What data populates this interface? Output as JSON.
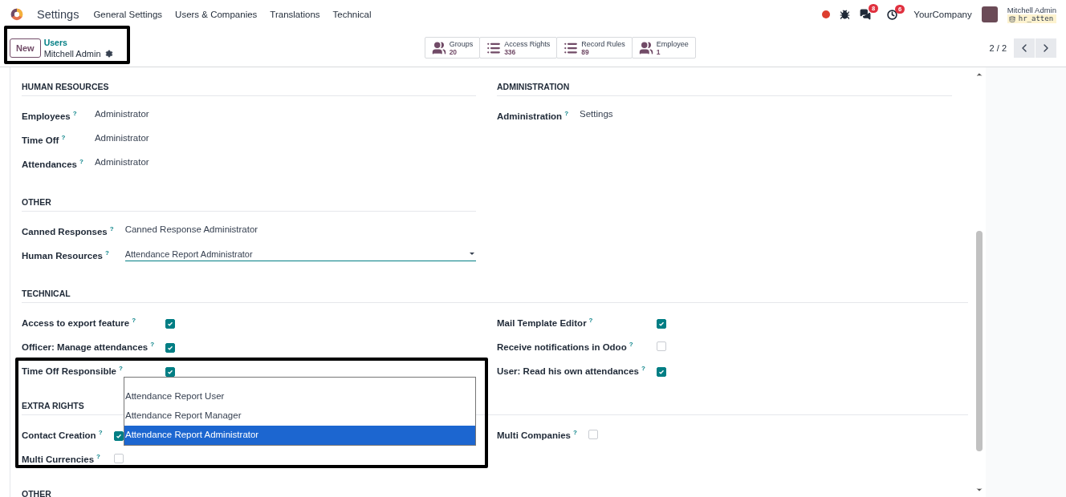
{
  "navbar": {
    "app": "Settings",
    "menus": [
      "General Settings",
      "Users & Companies",
      "Translations",
      "Technical"
    ],
    "messages_count": "8",
    "activities_count": "6",
    "company": "YourCompany",
    "user_name": "Mitchell Admin",
    "database": "hr_atten"
  },
  "control_panel": {
    "new_button": "New",
    "breadcrumb": "Users",
    "record": "Mitchell Admin",
    "smart_buttons": [
      {
        "kind": "group",
        "label": "Groups",
        "count": "20"
      },
      {
        "kind": "list",
        "label": "Access Rights",
        "count": "336"
      },
      {
        "kind": "list",
        "label": "Record Rules",
        "count": "89"
      },
      {
        "kind": "group",
        "label": "Employee",
        "count": "1"
      }
    ],
    "pager": "2 / 2"
  },
  "sections": [
    {
      "kind": "split",
      "left": {
        "title": "HUMAN RESOURCES",
        "fields": [
          {
            "kind": "value",
            "label": "Employees",
            "help": "?",
            "value": "Administrator"
          },
          {
            "kind": "value",
            "label": "Time Off",
            "help": "?",
            "value": "Administrator"
          },
          {
            "kind": "value",
            "label": "Attendances",
            "help": "?",
            "value": "Administrator"
          }
        ]
      },
      "right": {
        "title": "ADMINISTRATION",
        "fields": [
          {
            "kind": "value",
            "label": "Administration",
            "help": "?",
            "value": "Settings"
          }
        ]
      }
    },
    {
      "kind": "split",
      "left": {
        "title": "OTHER",
        "fields": [
          {
            "kind": "value",
            "label": "Canned Responses",
            "help": "?",
            "value": "Canned Response Administrator"
          },
          {
            "kind": "select",
            "label": "Human Resources",
            "help": "?",
            "value": "Attendance Report Administrator"
          }
        ]
      }
    },
    {
      "kind": "full",
      "title": "TECHNICAL",
      "left": {
        "fields": [
          {
            "kind": "checkbox",
            "label": "Access to export feature",
            "help": "?",
            "checked": true
          },
          {
            "kind": "checkbox",
            "label": "Officer: Manage attendances",
            "help": "?",
            "checked": true
          },
          {
            "kind": "checkbox",
            "label": "Time Off Responsible",
            "help": "?",
            "checked": true
          }
        ]
      },
      "right": {
        "fields": [
          {
            "kind": "checkbox",
            "label": "Mail Template Editor",
            "help": "?",
            "checked": true
          },
          {
            "kind": "checkbox",
            "label": "Receive notifications in Odoo",
            "help": "?",
            "checked": false
          },
          {
            "kind": "checkbox",
            "label": "User: Read his own attendances",
            "help": "?",
            "checked": true
          }
        ]
      }
    },
    {
      "kind": "full",
      "title": "EXTRA RIGHTS",
      "left": {
        "fields": [
          {
            "kind": "checkbox",
            "label": "Contact Creation",
            "help": "?",
            "checked": true
          },
          {
            "kind": "checkbox",
            "label": "Multi Currencies",
            "help": "?",
            "checked": false
          }
        ]
      },
      "right": {
        "fields": [
          {
            "kind": "checkbox",
            "label": "Multi Companies",
            "help": "?",
            "checked": false
          }
        ]
      }
    },
    {
      "kind": "full",
      "title": "OTHER"
    }
  ],
  "dropdown": {
    "options": [
      {
        "label": "Attendance Report User",
        "selected": false
      },
      {
        "label": "Attendance Report Manager",
        "selected": false
      },
      {
        "label": "Attendance Report Administrator",
        "selected": true
      }
    ]
  }
}
